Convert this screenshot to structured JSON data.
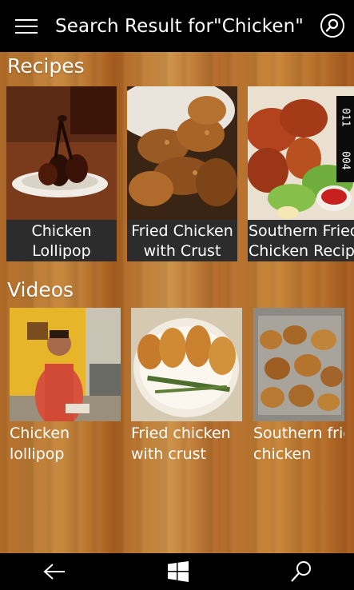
{
  "header": {
    "title": "Search Result for\"Chicken\"",
    "menu_icon": "hamburger-menu-icon",
    "search_icon": "search-icon"
  },
  "recipes": {
    "title": "Recipes",
    "items": [
      {
        "line1": "Chicken",
        "line2": "Lollipop"
      },
      {
        "line1": "Fried Chicken",
        "line2": "with Crust"
      },
      {
        "line1": "Southern Fried",
        "line2": "Chicken Recipe"
      }
    ]
  },
  "videos": {
    "title": "Videos",
    "items": [
      {
        "line1": "Chicken",
        "line2": "lollipop"
      },
      {
        "line1": "Fried chicken",
        "line2": "with crust"
      },
      {
        "line1": "Southern frie",
        "line2": "chicken"
      }
    ]
  },
  "scroll_indicator": {
    "top": "011",
    "bottom": "004"
  },
  "navbar": {
    "back_icon": "back-arrow-icon",
    "windows_icon": "windows-logo-icon",
    "search_icon": "search-icon"
  },
  "colors": {
    "bar": "#000000",
    "label_bg": "#2c2c2c",
    "wood": "#b8742f"
  }
}
